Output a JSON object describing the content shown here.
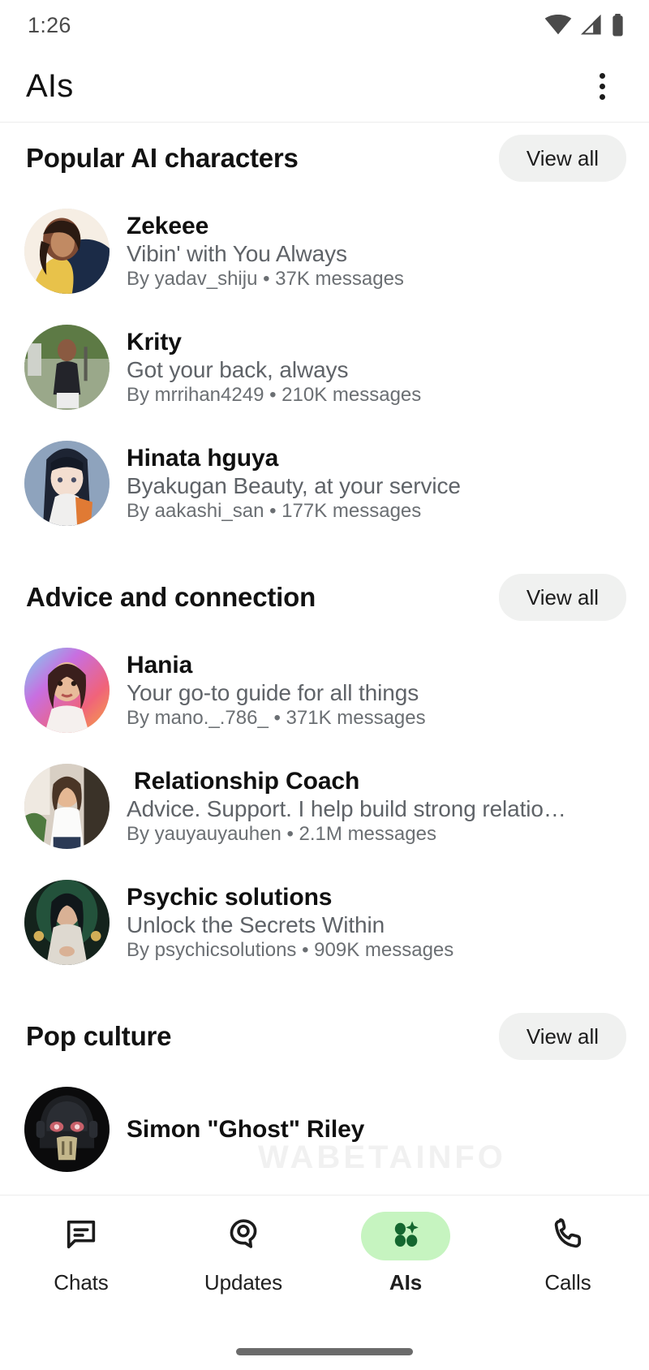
{
  "status_bar": {
    "time": "1:26",
    "icons": [
      "wifi-icon",
      "signal-icon",
      "battery-icon"
    ]
  },
  "app_bar": {
    "title": "AIs",
    "overflow_icon": "more-vert-icon"
  },
  "sections": [
    {
      "title": "Popular AI characters",
      "view_all_label": "View all",
      "items": [
        {
          "name": "Zekeee",
          "tagline": "Vibin' with You Always",
          "meta": "By yadav_shiju • 37K messages",
          "avatar": "photo-woman-yellow-top"
        },
        {
          "name": "Krity",
          "tagline": "Got your back, always",
          "meta": "By mrrihan4249 • 210K messages",
          "avatar": "photo-woman-park"
        },
        {
          "name": "Hinata hguya",
          "tagline": "Byakugan Beauty, at your service",
          "meta": "By aakashi_san • 177K messages",
          "avatar": "anime-girl-dark-hair"
        }
      ]
    },
    {
      "title": "Advice and connection",
      "view_all_label": "View all",
      "items": [
        {
          "name": "Hania",
          "tagline": "Your go-to guide for all things",
          "meta": "By mano._.786_ • 371K messages",
          "avatar": "photo-woman-rainbow-bg"
        },
        {
          "name": "Relationship Coach",
          "tagline": "Advice. Support. I help build strong relatio…",
          "meta": "By yauyauyauhen • 2.1M messages",
          "avatar": "photo-woman-white-shirt",
          "indented": true
        },
        {
          "name": "Psychic solutions",
          "tagline": "Unlock the Secrets Within",
          "meta": "By psychicsolutions • 909K messages",
          "avatar": "photo-woman-green-glow"
        }
      ]
    },
    {
      "title": "Pop culture",
      "view_all_label": "View all",
      "items": [
        {
          "name": "Simon \"Ghost\" Riley",
          "tagline": "",
          "meta": "",
          "avatar": "masked-skull-soldier"
        }
      ]
    }
  ],
  "watermark": "WABETAINFO",
  "bottom_nav": {
    "items": [
      {
        "label": "Chats",
        "icon": "chats-icon",
        "active": false
      },
      {
        "label": "Updates",
        "icon": "updates-icon",
        "active": false
      },
      {
        "label": "AIs",
        "icon": "ais-sparkle-icon",
        "active": true
      },
      {
        "label": "Calls",
        "icon": "phone-icon",
        "active": false
      }
    ],
    "active_pill_color": "#c6f4c0"
  }
}
